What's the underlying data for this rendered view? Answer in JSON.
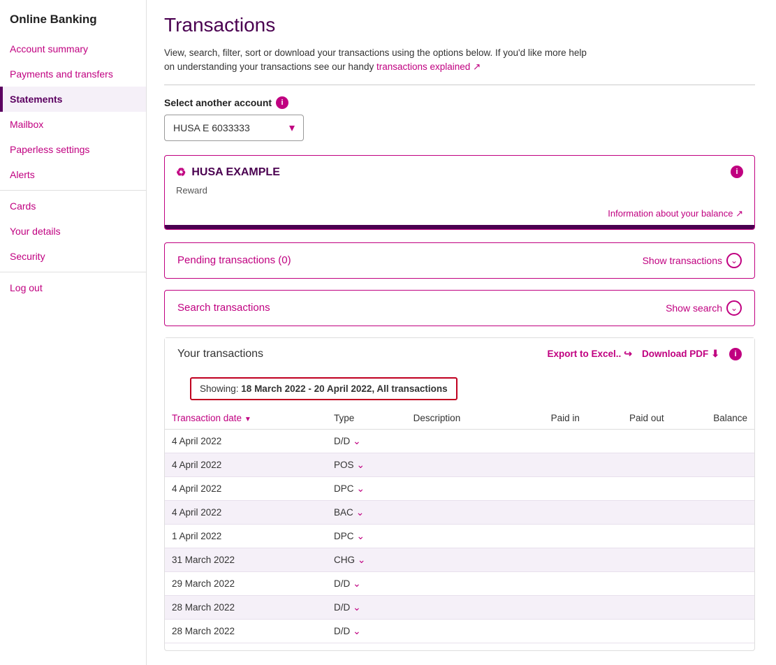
{
  "app": {
    "title": "Online Banking"
  },
  "sidebar": {
    "items": [
      {
        "id": "account-summary",
        "label": "Account summary",
        "active": false
      },
      {
        "id": "payments-transfers",
        "label": "Payments and transfers",
        "active": false
      },
      {
        "id": "statements",
        "label": "Statements",
        "active": true
      },
      {
        "id": "mailbox",
        "label": "Mailbox",
        "active": false
      },
      {
        "id": "paperless-settings",
        "label": "Paperless settings",
        "active": false
      },
      {
        "id": "alerts",
        "label": "Alerts",
        "active": false
      },
      {
        "id": "cards",
        "label": "Cards",
        "active": false
      },
      {
        "id": "your-details",
        "label": "Your details",
        "active": false
      },
      {
        "id": "security",
        "label": "Security",
        "active": false
      },
      {
        "id": "log-out",
        "label": "Log out",
        "active": false
      }
    ]
  },
  "main": {
    "page_title": "Transactions",
    "intro_text1": "View, search, filter, sort or download your transactions using the options below. If you'd like more help",
    "intro_text2": "on understanding your transactions see our handy",
    "intro_link": "transactions explained ↗",
    "account_selector": {
      "label": "Select another account",
      "value": "HUSA E 6033333"
    },
    "account_card": {
      "name": "HUSA EXAMPLE",
      "type": "Reward",
      "balance_link": "Information about your balance ↗"
    },
    "pending_panel": {
      "title": "Pending transactions (0)",
      "action": "Show transactions"
    },
    "search_panel": {
      "title": "Search transactions",
      "action": "Show search"
    },
    "transactions_section": {
      "title": "Your transactions",
      "export_label": "Export to Excel..",
      "download_label": "Download PDF",
      "showing_text": "Showing: ",
      "showing_range": "18 March 2022 - 20 April 2022, All transactions",
      "table": {
        "headers": [
          "Transaction date",
          "Type",
          "Description",
          "Paid in",
          "Paid out",
          "Balance"
        ],
        "rows": [
          {
            "date": "4 April 2022",
            "type": "D/D",
            "description": "",
            "paid_in": "",
            "paid_out": "",
            "balance": ""
          },
          {
            "date": "4 April 2022",
            "type": "POS",
            "description": "",
            "paid_in": "",
            "paid_out": "",
            "balance": ""
          },
          {
            "date": "4 April 2022",
            "type": "DPC",
            "description": "",
            "paid_in": "",
            "paid_out": "",
            "balance": ""
          },
          {
            "date": "4 April 2022",
            "type": "BAC",
            "description": "",
            "paid_in": "",
            "paid_out": "",
            "balance": ""
          },
          {
            "date": "1 April 2022",
            "type": "DPC",
            "description": "",
            "paid_in": "",
            "paid_out": "",
            "balance": ""
          },
          {
            "date": "31 March 2022",
            "type": "CHG",
            "description": "",
            "paid_in": "",
            "paid_out": "",
            "balance": ""
          },
          {
            "date": "29 March 2022",
            "type": "D/D",
            "description": "",
            "paid_in": "",
            "paid_out": "",
            "balance": ""
          },
          {
            "date": "28 March 2022",
            "type": "D/D",
            "description": "",
            "paid_in": "",
            "paid_out": "",
            "balance": ""
          },
          {
            "date": "28 March 2022",
            "type": "D/D",
            "description": "",
            "paid_in": "",
            "paid_out": "",
            "balance": ""
          }
        ]
      }
    }
  }
}
